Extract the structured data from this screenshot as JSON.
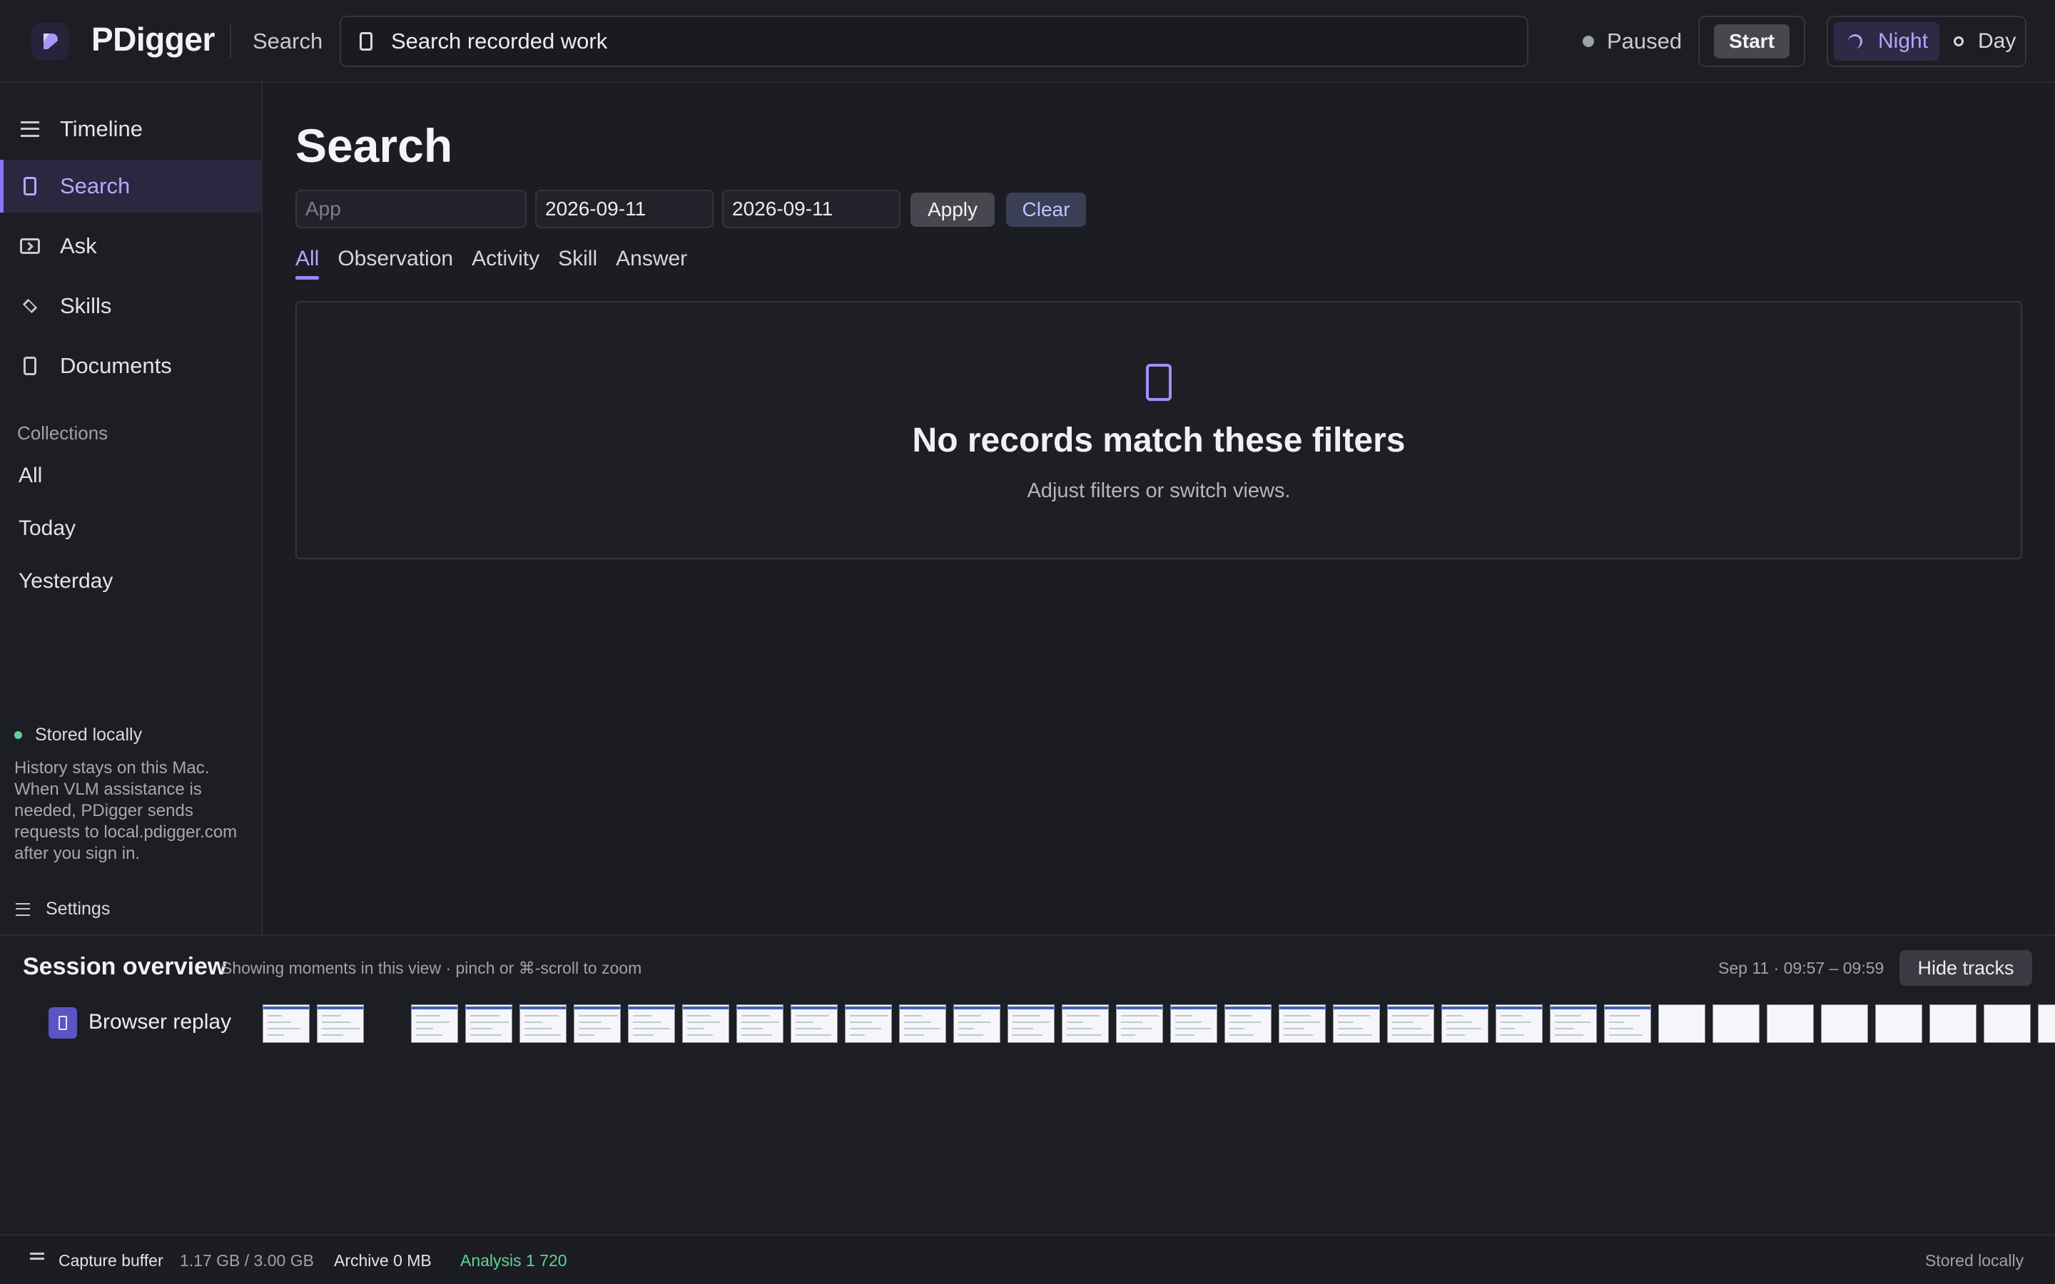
{
  "header": {
    "app_title": "PDigger",
    "breadcrumb": "Search",
    "search_placeholder": "Search recorded work",
    "status_text": "Paused",
    "start_label": "Start",
    "theme_night_label": "Night",
    "theme_day_label": "Day"
  },
  "sidebar": {
    "nav": [
      {
        "label": "Timeline",
        "icon": "menu-icon"
      },
      {
        "label": "Search",
        "icon": "document-icon",
        "active": true
      },
      {
        "label": "Ask",
        "icon": "terminal-icon"
      },
      {
        "label": "Skills",
        "icon": "diamond-icon"
      },
      {
        "label": "Documents",
        "icon": "document-icon"
      }
    ],
    "collections_heading": "Collections",
    "collections": [
      "All",
      "Today",
      "Yesterday"
    ],
    "stored_label": "Stored locally",
    "stored_description": "History stays on this Mac. When VLM assistance is needed, PDigger sends requests to local.pdigger.com after you sign in.",
    "settings_label": "Settings"
  },
  "main": {
    "title": "Search",
    "filters": {
      "app_placeholder": "App",
      "date_from": "2026-09-11",
      "date_to": "2026-09-11",
      "apply_label": "Apply",
      "clear_label": "Clear"
    },
    "tabs": [
      "All",
      "Observation",
      "Activity",
      "Skill",
      "Answer"
    ],
    "active_tab": "All",
    "empty": {
      "title": "No records match these filters",
      "subtitle": "Adjust filters or switch views."
    }
  },
  "session": {
    "title": "Session overview",
    "hint": "Showing moments in this view · pinch or ⌘-scroll to zoom",
    "range": "Sep 11 · 09:57 – 09:59",
    "hide_tracks_label": "Hide tracks",
    "track_label": "Browser replay",
    "thumbnail_count": 33
  },
  "statusbar": {
    "capture_label": "Capture buffer",
    "capture_value": "1.17 GB / 3.00 GB",
    "archive": "Archive 0 MB",
    "analysis": "Analysis 1 720",
    "stored": "Stored locally"
  },
  "colors": {
    "accent": "#8b74ff",
    "accent_text": "#b6a5ff",
    "background": "#1c1d22",
    "success": "#5fd39a"
  }
}
